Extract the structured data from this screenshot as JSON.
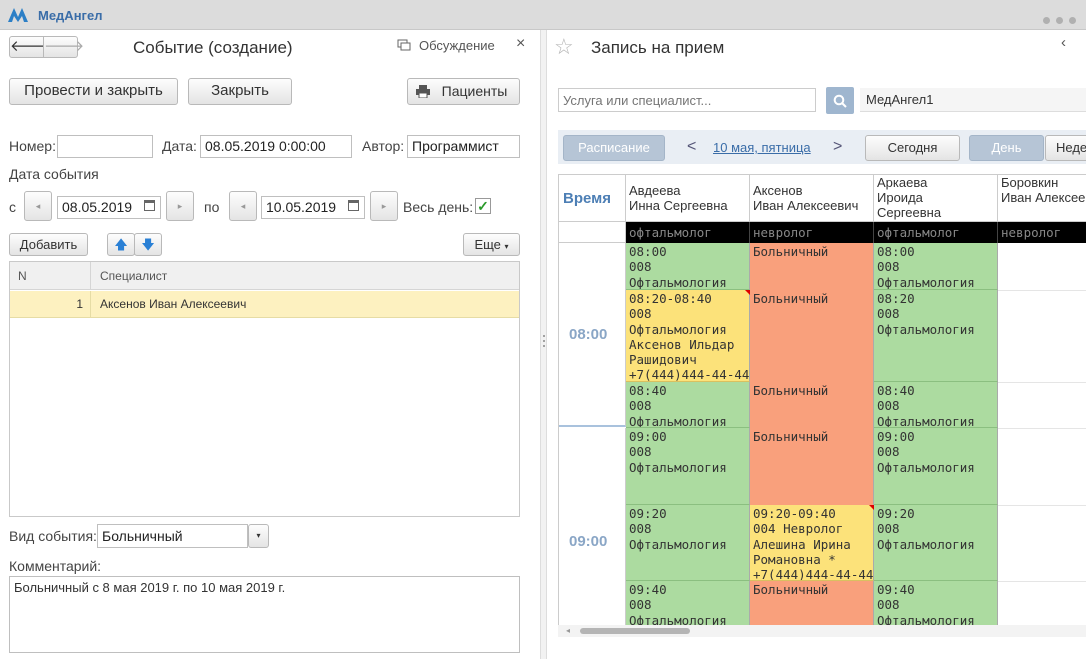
{
  "app": {
    "name": "МедАнгел"
  },
  "left": {
    "title": "Событие (создание)",
    "discussion": "Обсуждение",
    "close": "×",
    "btn_post_close": "Провести и закрыть",
    "btn_close": "Закрыть",
    "btn_patients": "Пациенты",
    "number_label": "Номер:",
    "number_value": "",
    "date_label": "Дата:",
    "date_value": "08.05.2019  0:00:00",
    "author_label": "Автор:",
    "author_value": "Программист",
    "event_date_label": "Дата события",
    "from_label": "с",
    "from_value": "08.05.2019",
    "to_label": "по",
    "to_value": "10.05.2019",
    "allday_label": "Весь день:",
    "btn_add": "Добавить",
    "btn_more": "Еще",
    "col_n": "N",
    "col_spec": "Специалист",
    "rows": [
      {
        "n": "1",
        "spec": "Аксенов Иван Алексеевич"
      }
    ],
    "event_type_label": "Вид события:",
    "event_type_value": "Больничный",
    "comment_label": "Комментарий:",
    "comment_value": "Больничный с 8 мая 2019 г. по 10 мая 2019 г."
  },
  "right": {
    "title": "Запись на прием",
    "collapse": "‹",
    "search_placeholder": "Услуга или специалист...",
    "org": "МедАнгел1",
    "tab_schedule": "Расписание",
    "prev": "<",
    "date": "10 мая, пятница",
    "next": ">",
    "btn_today": "Сегодня",
    "btn_day": "День",
    "btn_week": "Неделя",
    "time_header": "Время",
    "time_0800": "08:00",
    "time_0900": "09:00",
    "specialists": [
      {
        "name": "Авдеева\nИнна Сергеевна",
        "role": "офтальмолог"
      },
      {
        "name": "Аксенов\nИван Алексеевич",
        "role": "невролог"
      },
      {
        "name": "Аркаева\nИроида\nСергеевна",
        "role": "офтальмолог"
      },
      {
        "name": "Боровкин\nИван Алексеевич",
        "role": "невролог"
      }
    ],
    "col1": [
      "08:00\n008\nОфтальмология",
      "08:20-08:40\n008\nОфтальмология\nАксенов Ильдар\nРашидович\n+7(444)444-44-44",
      "08:40\n008\nОфтальмология",
      "09:00\n008\nОфтальмология",
      "09:20\n008\nОфтальмология",
      "09:40\n008\nОфтальмология"
    ],
    "col2": [
      "Больничный",
      "Больничный",
      "Больничный",
      "Больничный",
      "09:20-09:40\n004 Невролог\nАлешина Ирина\nРомановна *\n+7(444)444-44-44",
      "Больничный"
    ],
    "col3": [
      "08:00\n008\nОфтальмология",
      "08:20\n008\nОфтальмология",
      "08:40\n008\nОфтальмология",
      "09:00\n008\nОфтальмология",
      "09:20\n008\nОфтальмология",
      "09:40\n008\nОфтальмология"
    ]
  }
}
